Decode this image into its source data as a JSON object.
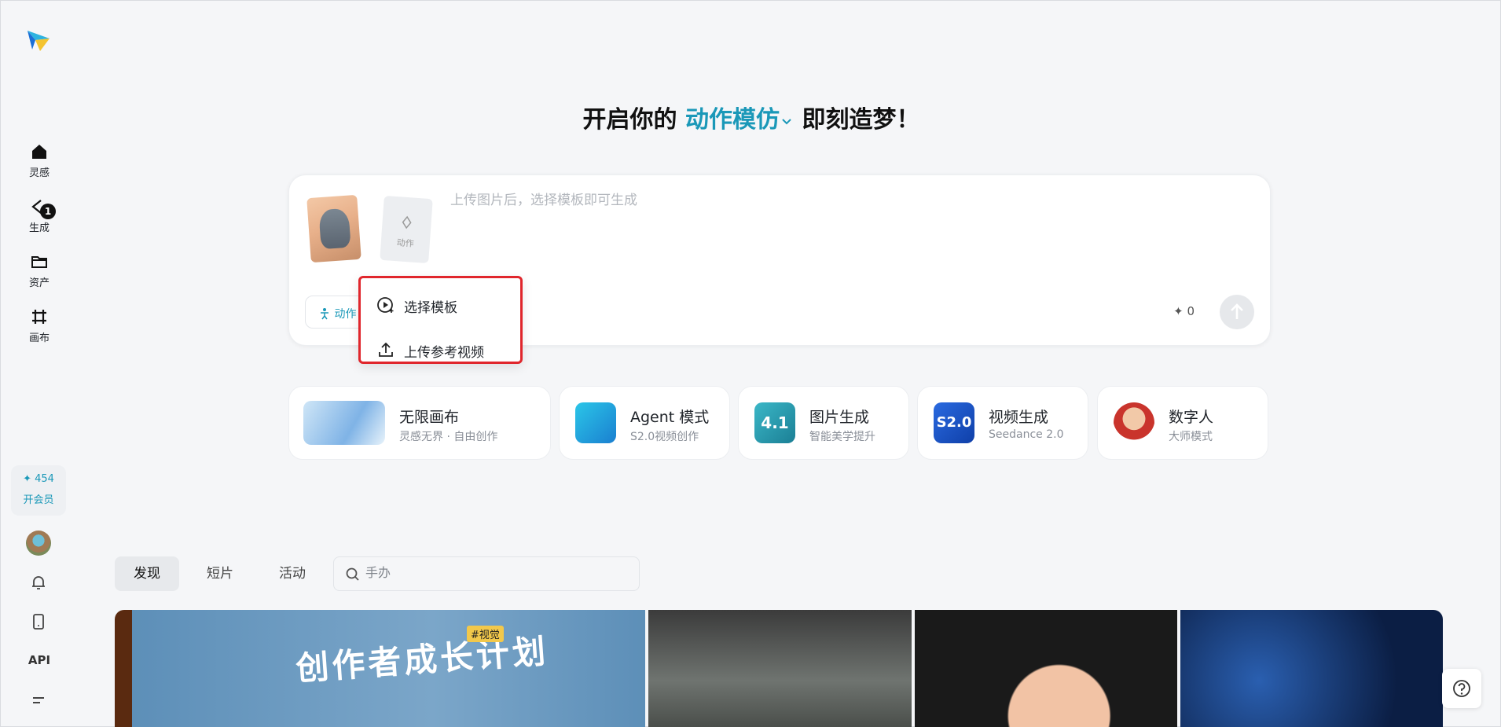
{
  "sidebar": {
    "items": [
      {
        "label": "灵感",
        "icon": "home-icon"
      },
      {
        "label": "生成",
        "icon": "generate-icon",
        "badge": "1"
      },
      {
        "label": "资产",
        "icon": "folder-icon"
      },
      {
        "label": "画布",
        "icon": "canvas-icon"
      }
    ],
    "credits": "454",
    "vip_label": "开会员",
    "api_label": "API"
  },
  "headline": {
    "prefix": "开启你的 ",
    "mode": "动作模仿",
    "suffix": " 即刻造梦！"
  },
  "composer": {
    "action_thumb_label": "动作",
    "placeholder": "上传图片后，选择模板即可生成",
    "mode_chip_label": "动作",
    "cost": "0"
  },
  "dropdown": {
    "items": [
      {
        "label": "选择模板",
        "icon": "play-template-icon"
      },
      {
        "label": "上传参考视频",
        "icon": "upload-icon"
      }
    ]
  },
  "features": [
    {
      "title": "无限画布",
      "subtitle": "灵感无界 · 自由创作",
      "icon": "pegasus-icon"
    },
    {
      "title": "Agent 模式",
      "subtitle": "S2.0视频创作",
      "icon": "agent-icon"
    },
    {
      "title": "图片生成",
      "subtitle": "智能美学提升",
      "icon": "image-gen-icon"
    },
    {
      "title": "视频生成",
      "subtitle": "Seedance 2.0",
      "icon": "video-gen-icon"
    },
    {
      "title": "数字人",
      "subtitle": "大师模式",
      "icon": "digital-human-icon"
    }
  ],
  "tabs": [
    "发现",
    "短片",
    "活动"
  ],
  "search": {
    "placeholder": "手办"
  },
  "gallery": {
    "banner_text": "创作者成长计划",
    "banner_tag": "#视觉"
  },
  "colors": {
    "accent": "#1a98b8",
    "highlight_border": "#e0262c",
    "background": "#f5f6f8"
  }
}
